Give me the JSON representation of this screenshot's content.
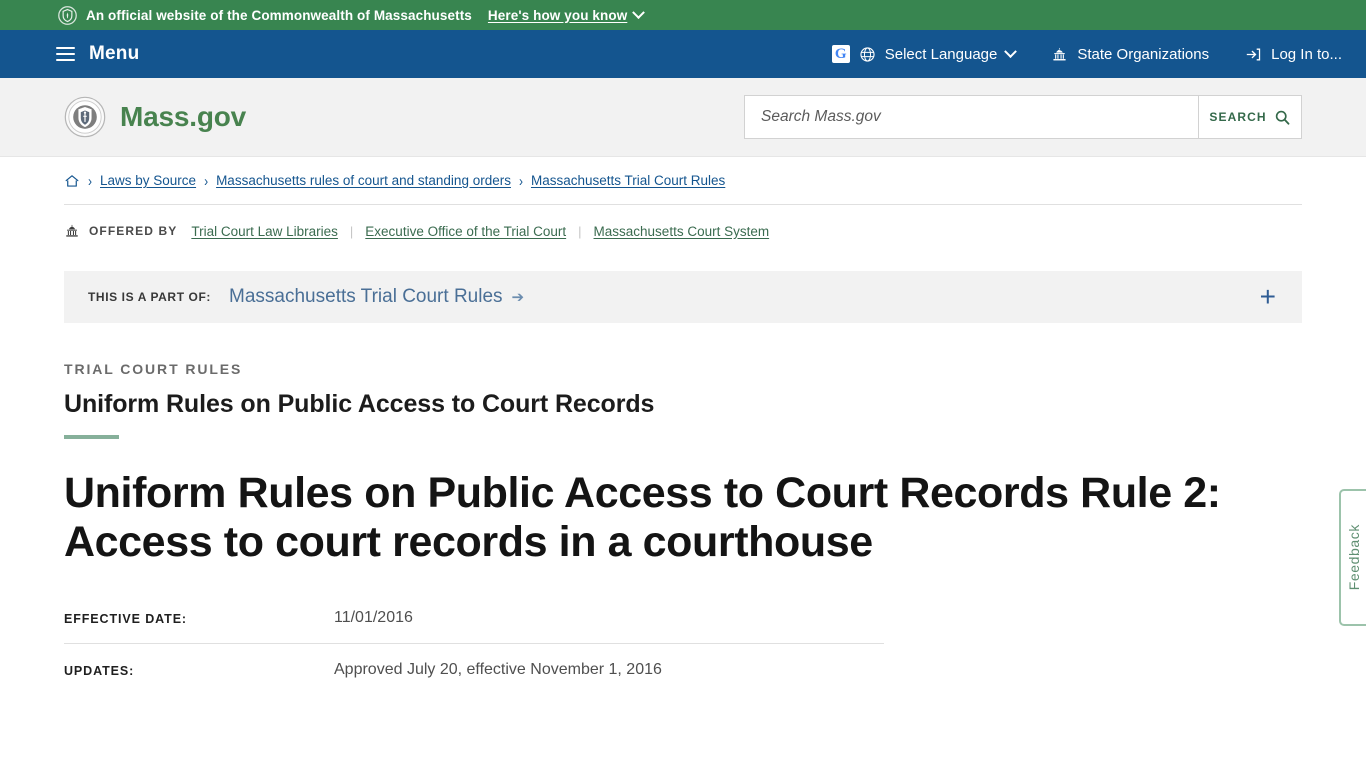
{
  "gov_banner": {
    "icon": "shield-icon",
    "text": "An official website of the Commonwealth of Massachusetts",
    "disclosure_label": "Here's how you know"
  },
  "utility_nav": {
    "menu_label": "Menu",
    "items": [
      {
        "label": "Select Language",
        "icon": "globe-icon",
        "has_caret": true
      },
      {
        "label": "State Organizations",
        "icon": "capitol-icon",
        "has_caret": false
      },
      {
        "label": "Log In to...",
        "icon": "login-icon",
        "has_caret": false
      }
    ]
  },
  "brand": {
    "name": "Mass.gov",
    "seal_icon": "commonwealth-seal-icon",
    "brand_color": "#48834f"
  },
  "search": {
    "placeholder": "Search Mass.gov",
    "value": "",
    "button_label": "SEARCH",
    "button_icon": "search-icon"
  },
  "breadcrumb": {
    "home_icon": "home-icon",
    "items": [
      "Laws by Source",
      "Massachusetts rules of court and standing orders",
      "Massachusetts Trial Court Rules"
    ],
    "separator": "›"
  },
  "offered_by": {
    "icon": "capitol-icon",
    "label": "OFFERED BY",
    "organizations": [
      "Trial Court Law Libraries",
      "Executive Office of the Trial Court",
      "Massachusetts Court System"
    ]
  },
  "part_of": {
    "label": "THIS IS A PART OF:",
    "link": "Massachusetts Trial Court Rules",
    "arrow_icon": "arrow-right-icon",
    "expand_icon": "plus-icon",
    "expand_label": "+"
  },
  "page": {
    "eyebrow": "TRIAL COURT RULES",
    "subtitle": "Uniform Rules on Public Access to Court Records",
    "title": "Uniform Rules on Public Access to Court Records Rule 2: Access to court records in a courthouse",
    "accent_color": "#86b09a"
  },
  "metadata": [
    {
      "key": "EFFECTIVE DATE:",
      "value": "11/01/2016"
    },
    {
      "key": "UPDATES:",
      "value": "Approved July 20, effective November 1, 2016"
    }
  ],
  "feedback": {
    "label": "Feedback"
  },
  "colors": {
    "banner_green": "#388550",
    "nav_blue": "#14558f",
    "link_blue": "#14558f",
    "link_green": "#3a6b4f",
    "band_gray": "#f2f2f2"
  }
}
